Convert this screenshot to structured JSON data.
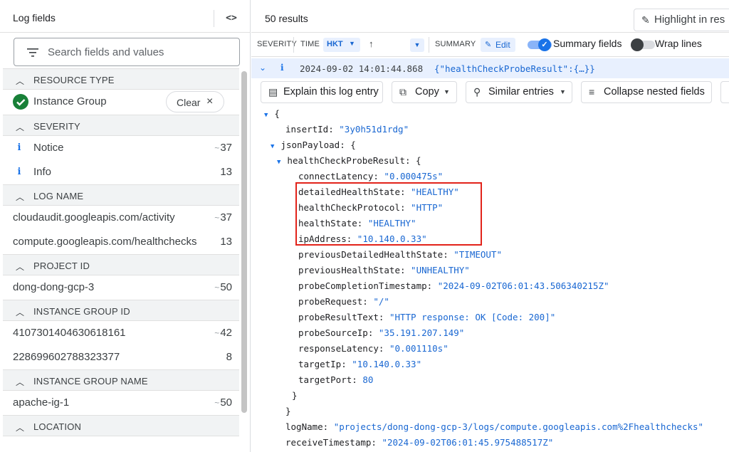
{
  "left_panel": {
    "title": "Log fields",
    "collapse_icon": "<>",
    "search_placeholder": "Search fields and values",
    "sections": {
      "resource_type": "RESOURCE TYPE",
      "severity": "SEVERITY",
      "log_name": "LOG NAME",
      "project_id": "PROJECT ID",
      "instance_group_id": "INSTANCE GROUP ID",
      "instance_group_name": "INSTANCE GROUP NAME",
      "location": "LOCATION"
    },
    "resource_type_value": "Instance Group",
    "clear_label": "Clear",
    "severity_items": [
      {
        "label": "Notice",
        "count": "37",
        "approx": true
      },
      {
        "label": "Info",
        "count": "13",
        "approx": false
      }
    ],
    "log_name_items": [
      {
        "label": "cloudaudit.googleapis.com/activity",
        "count": "37",
        "approx": true
      },
      {
        "label": "compute.googleapis.com/healthchecks",
        "count": "13",
        "approx": false
      }
    ],
    "project_items": [
      {
        "label": "dong-dong-gcp-3",
        "count": "50",
        "approx": true
      }
    ],
    "instance_group_id_items": [
      {
        "label": "4107301404630618161",
        "count": "42",
        "approx": true
      },
      {
        "label": "228699602788323377",
        "count": "8",
        "approx": false
      }
    ],
    "instance_group_name_items": [
      {
        "label": "apache-ig-1",
        "count": "50",
        "approx": true
      }
    ]
  },
  "results": {
    "count_label": "50 results",
    "highlight_label": "Highlight in res",
    "columns": {
      "severity": "SEVERITY",
      "time": "TIME",
      "timezone": "HKT",
      "summary": "SUMMARY",
      "edit": "Edit",
      "summary_fields": "Summary fields",
      "wrap_lines": "Wrap lines"
    },
    "entry": {
      "timestamp": "2024-09-02 14:01:44.868",
      "summary": "{\"healthCheckProbeResult\":{…}}"
    },
    "actions": {
      "explain": "Explain this log entry",
      "copy": "Copy",
      "similar": "Similar entries",
      "collapse": "Collapse nested fields"
    },
    "json_lines": {
      "open_brace": "{",
      "insertId_key": "insertId:",
      "insertId_val": "\"3y0h51d1rdg\"",
      "jsonPayload_key": "jsonPayload: {",
      "hcpr_key": "healthCheckProbeResult: {",
      "connectLatency_key": "connectLatency:",
      "connectLatency_val": "\"0.000475s\"",
      "detailedHealthState_key": "detailedHealthState:",
      "detailedHealthState_val": "\"HEALTHY\"",
      "healthCheckProtocol_key": "healthCheckProtocol:",
      "healthCheckProtocol_val": "\"HTTP\"",
      "healthState_key": "healthState:",
      "healthState_val": "\"HEALTHY\"",
      "ipAddress_key": "ipAddress:",
      "ipAddress_val": "\"10.140.0.33\"",
      "previousDetailedHealthState_key": "previousDetailedHealthState:",
      "previousDetailedHealthState_val": "\"TIMEOUT\"",
      "previousHealthState_key": "previousHealthState:",
      "previousHealthState_val": "\"UNHEALTHY\"",
      "probeCompletionTimestamp_key": "probeCompletionTimestamp:",
      "probeCompletionTimestamp_val": "\"2024-09-02T06:01:43.506340215Z\"",
      "probeRequest_key": "probeRequest:",
      "probeRequest_val": "\"/\"",
      "probeResultText_key": "probeResultText:",
      "probeResultText_val": "\"HTTP response: OK [Code: 200]\"",
      "probeSourceIp_key": "probeSourceIp:",
      "probeSourceIp_val": "\"35.191.207.149\"",
      "responseLatency_key": "responseLatency:",
      "responseLatency_val": "\"0.001110s\"",
      "targetIp_key": "targetIp:",
      "targetIp_val": "\"10.140.0.33\"",
      "targetPort_key": "targetPort:",
      "targetPort_val": "80",
      "close1": "}",
      "close2": "}",
      "logName_key": "logName:",
      "logName_val": "\"projects/dong-dong-gcp-3/logs/compute.googleapis.com%2Fhealthchecks\"",
      "receiveTimestamp_key": "receiveTimestamp:",
      "receiveTimestamp_val": "\"2024-09-02T06:01:45.975488517Z\""
    }
  },
  "colors": {
    "accent": "#1a73e8",
    "selected_row": "#e8f0fe",
    "highlight_box": "#e2231a",
    "success": "#188038"
  }
}
